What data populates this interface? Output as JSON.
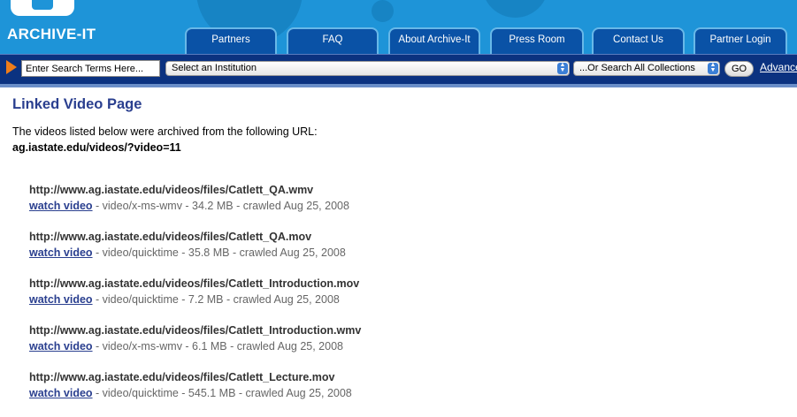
{
  "header": {
    "logo_text": "ARCHIVE-IT",
    "nav_tabs": [
      {
        "label": "Partners"
      },
      {
        "label": "FAQ"
      },
      {
        "label": "About Archive-It"
      },
      {
        "label": "Press Room"
      },
      {
        "label": "Contact Us"
      },
      {
        "label": "Partner Login"
      }
    ]
  },
  "search": {
    "placeholder": "Enter Search Terms Here...",
    "institution_select": "Select an Institution",
    "collections_select": "...Or Search All Collections",
    "go_label": "GO",
    "advanced_label": "Advanced"
  },
  "page": {
    "title": "Linked Video Page",
    "intro": "The videos listed below were archived from the following URL:",
    "source_url": "ag.iastate.edu/videos/?video=11"
  },
  "videos": [
    {
      "url": "http://www.ag.iastate.edu/videos/files/Catlett_QA.wmv",
      "link": "watch video",
      "meta": " - video/x-ms-wmv - 34.2 MB - crawled Aug 25, 2008"
    },
    {
      "url": "http://www.ag.iastate.edu/videos/files/Catlett_QA.mov",
      "link": "watch video",
      "meta": " - video/quicktime - 35.8 MB - crawled Aug 25, 2008"
    },
    {
      "url": "http://www.ag.iastate.edu/videos/files/Catlett_Introduction.mov",
      "link": "watch video",
      "meta": " - video/quicktime - 7.2 MB - crawled Aug 25, 2008"
    },
    {
      "url": "http://www.ag.iastate.edu/videos/files/Catlett_Introduction.wmv",
      "link": "watch video",
      "meta": " - video/x-ms-wmv - 6.1 MB - crawled Aug 25, 2008"
    },
    {
      "url": "http://www.ag.iastate.edu/videos/files/Catlett_Lecture.mov",
      "link": "watch video",
      "meta": " - video/quicktime - 545.1 MB - crawled Aug 25, 2008"
    }
  ],
  "colors": {
    "header_blue": "#1e94d8",
    "tab_blue": "#0a52a6",
    "search_bar_navy": "#0b3280",
    "title_blue": "#2a3f8f",
    "accent_orange": "#ef7d1a"
  }
}
